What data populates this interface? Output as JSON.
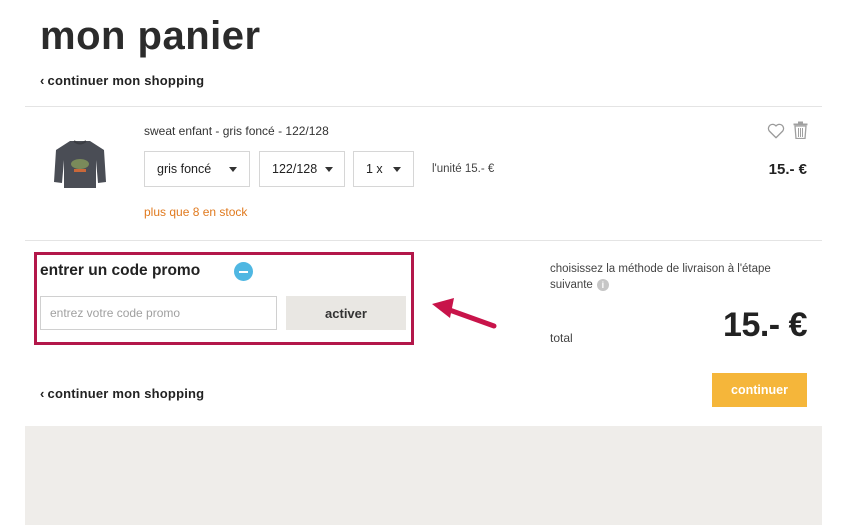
{
  "page": {
    "title": "mon panier",
    "continue_shopping_top": "continuer mon shopping",
    "continue_shopping_bottom": "continuer mon shopping"
  },
  "cart_item": {
    "name": "sweat enfant - gris foncé - 122/128",
    "color_select": "gris foncé",
    "size_select": "122/128",
    "quantity_select": "1 x",
    "unit_price": "l'unité 15.- €",
    "line_total": "15.- €",
    "stock_note": "plus que 8 en stock",
    "image": "dark-grey-kids-sweatshirt",
    "icons": [
      "heart-icon",
      "trash-icon"
    ]
  },
  "promo": {
    "title": "entrer un code promo",
    "input_placeholder": "entrez votre code promo",
    "input_value": "",
    "activate_label": "activer",
    "highlight_color": "#b3174a"
  },
  "summary": {
    "delivery_note": "choisissez la méthode de livraison à l'étape suivante",
    "total_label": "total",
    "total_amount": "15.- €",
    "continue_label": "continuer"
  },
  "colors": {
    "accent_button": "#f5b63a",
    "stock_warning": "#e07a1f",
    "promo_toggle": "#4fb7e2",
    "footer_bg": "#efedea"
  }
}
